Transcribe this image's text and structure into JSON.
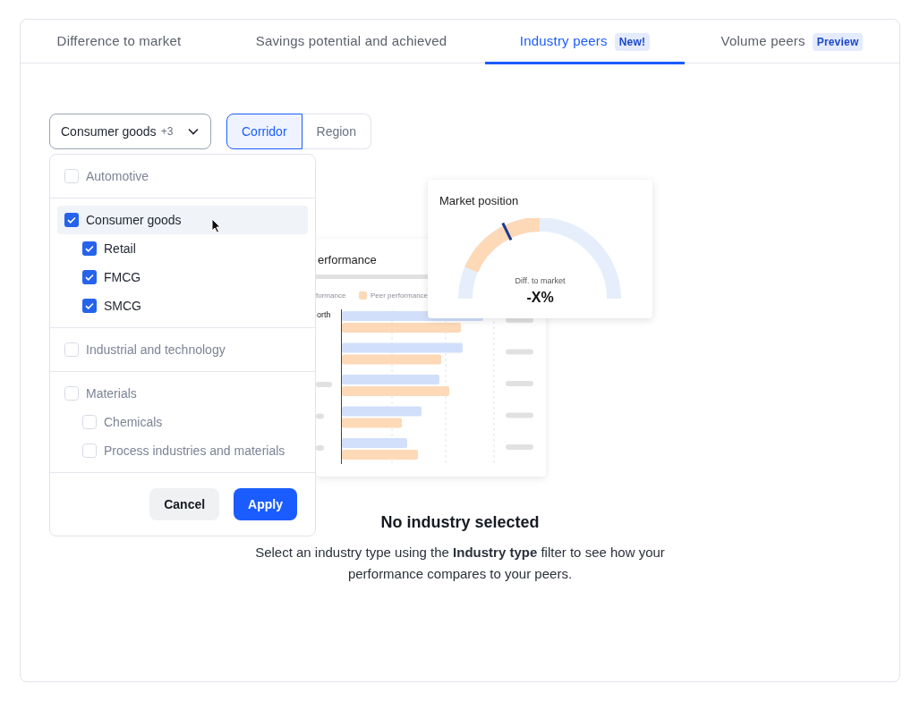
{
  "tabs": [
    {
      "label": "Difference to market",
      "selected": false
    },
    {
      "label": "Savings potential and achieved",
      "selected": false
    },
    {
      "label": "Industry peers",
      "badge": "New!",
      "selected": true
    },
    {
      "label": "Volume peers",
      "badge": "Preview",
      "selected": false
    }
  ],
  "industry_filter": {
    "label": "Consumer goods",
    "count": "+3",
    "expanded": true
  },
  "view_toggle": [
    {
      "label": "Corridor",
      "selected": true
    },
    {
      "label": "Region",
      "selected": false
    }
  ],
  "dropdown": {
    "groups": [
      {
        "label": "Automotive",
        "checked": false,
        "highlighted": false
      },
      {
        "label": "Consumer goods",
        "checked": true,
        "highlighted": true,
        "children": [
          {
            "label": "Retail",
            "checked": true
          },
          {
            "label": "FMCG",
            "checked": true
          },
          {
            "label": "SMCG",
            "checked": true
          }
        ]
      },
      {
        "label": "Industrial and technology",
        "checked": false,
        "highlighted": false
      },
      {
        "label": "Materials",
        "checked": false,
        "highlighted": false,
        "children": [
          {
            "label": "Chemicals",
            "checked": false
          },
          {
            "label": "Process industries and materials",
            "checked": false
          }
        ]
      }
    ],
    "buttons": [
      {
        "label": "Cancel",
        "kind": "secondary"
      },
      {
        "label": "Apply",
        "kind": "primary"
      }
    ]
  },
  "illustration": {
    "chart_card": {
      "title": "erformance",
      "legend": [
        "formance",
        "Peer performance"
      ],
      "row_label": "orth"
    },
    "gauge_card": {
      "title": "Market position",
      "caption": "Diff. to market",
      "value": "-X%"
    }
  },
  "empty_state": {
    "title": "No industry selected",
    "message": "Select an industry type using the **Industry type** filter to see how your performance compares to your peers."
  }
}
